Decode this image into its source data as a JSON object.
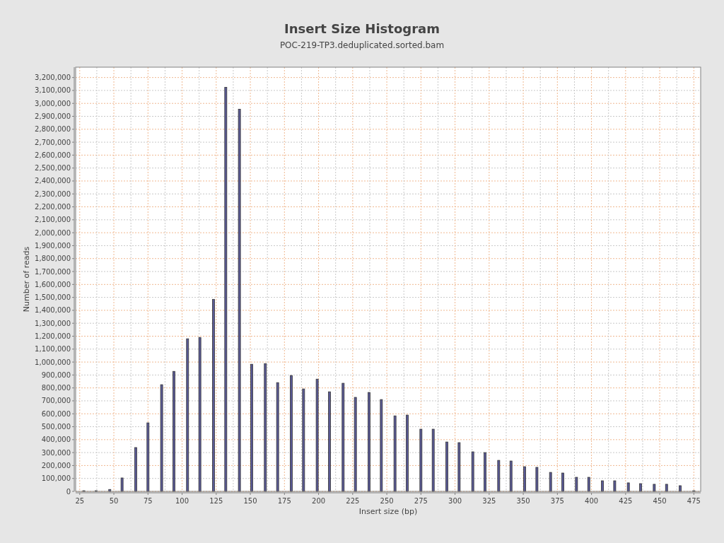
{
  "chart": {
    "chart_data": {
      "type": "bar",
      "title": "Insert Size Histogram",
      "subtitle": "POC-219-TP3.deduplicated.sorted.bam",
      "xlabel": "Insert size (bp)",
      "ylabel": "Number of reads",
      "x": [
        28,
        37,
        47,
        56,
        66,
        75,
        85,
        94,
        104,
        113,
        123,
        132,
        142,
        151,
        161,
        170,
        180,
        189,
        199,
        208,
        218,
        227,
        237,
        246,
        256,
        265,
        275,
        284,
        294,
        303,
        313,
        322,
        332,
        341,
        351,
        360,
        370,
        379,
        389,
        398,
        408,
        417,
        427,
        436,
        446,
        455,
        465,
        475
      ],
      "series": [
        {
          "color": "#5a5a96",
          "values": [
            5000,
            5000,
            15000,
            104000,
            339000,
            530000,
            825000,
            928000,
            1180000,
            1190000,
            1485000,
            3124000,
            2955000,
            983000,
            988000,
            841000,
            896000,
            792000,
            868000,
            770000,
            836000,
            727000,
            765000,
            710000,
            584000,
            590000,
            481000,
            481000,
            382000,
            377000,
            306000,
            300000,
            240000,
            235000,
            191000,
            186000,
            147000,
            142000,
            109000,
            109000,
            82000,
            82000,
            66000,
            60000,
            55000,
            55000,
            44000,
            5000
          ]
        }
      ],
      "xlim": [
        22,
        480
      ],
      "grid": true,
      "ylim": [
        0,
        3280000
      ],
      "xticks": [
        25,
        50,
        75,
        100,
        125,
        150,
        175,
        200,
        225,
        250,
        275,
        300,
        325,
        350,
        375,
        400,
        425,
        450,
        475
      ],
      "yticks": [
        {
          "value": 0,
          "label": "0"
        },
        {
          "value": 100000,
          "label": "100,000"
        },
        {
          "value": 200000,
          "label": "200,000"
        },
        {
          "value": 300000,
          "label": "300,000"
        },
        {
          "value": 400000,
          "label": "400,000"
        },
        {
          "value": 500000,
          "label": "500,000"
        },
        {
          "value": 600000,
          "label": "600,000"
        },
        {
          "value": 700000,
          "label": "700,000"
        },
        {
          "value": 800000,
          "label": "800,000"
        },
        {
          "value": 900000,
          "label": "900,000"
        },
        {
          "value": 1000000,
          "label": "1,000,000"
        },
        {
          "value": 1100000,
          "label": "1,100,000"
        },
        {
          "value": 1200000,
          "label": "1,200,000"
        },
        {
          "value": 1300000,
          "label": "1,300,000"
        },
        {
          "value": 1400000,
          "label": "1,400,000"
        },
        {
          "value": 1500000,
          "label": "1,500,000"
        },
        {
          "value": 1600000,
          "label": "1,600,000"
        },
        {
          "value": 1700000,
          "label": "1,700,000"
        },
        {
          "value": 1800000,
          "label": "1,800,000"
        },
        {
          "value": 1900000,
          "label": "1,900,000"
        },
        {
          "value": 2000000,
          "label": "2,000,000"
        },
        {
          "value": 2100000,
          "label": "2,100,000"
        },
        {
          "value": 2200000,
          "label": "2,200,000"
        },
        {
          "value": 2300000,
          "label": "2,300,000"
        },
        {
          "value": 2400000,
          "label": "2,400,000"
        },
        {
          "value": 2500000,
          "label": "2,500,000"
        },
        {
          "value": 2600000,
          "label": "2,600,000"
        },
        {
          "value": 2700000,
          "label": "2,700,000"
        },
        {
          "value": 2800000,
          "label": "2,800,000"
        },
        {
          "value": 2900000,
          "label": "2,900,000"
        },
        {
          "value": 3000000,
          "label": "3,000,000"
        },
        {
          "value": 3100000,
          "label": "3,100,000"
        },
        {
          "value": 3200000,
          "label": "3,200,000"
        }
      ]
    }
  }
}
